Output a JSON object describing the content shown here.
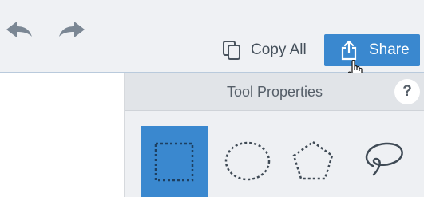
{
  "toolbar": {
    "undo_icon": "undo-arrow-icon",
    "redo_icon": "redo-arrow-icon",
    "copy_all_label": "Copy All",
    "copy_all_icon": "copy-icon",
    "share_label": "Share",
    "share_icon": "share-upload-icon"
  },
  "tool_properties": {
    "title": "Tool Properties",
    "help_label": "?",
    "tools": [
      {
        "name": "rectangle-selection",
        "icon": "dashed-rectangle-icon",
        "selected": true
      },
      {
        "name": "ellipse-selection",
        "icon": "dashed-ellipse-icon",
        "selected": false
      },
      {
        "name": "polygon-selection",
        "icon": "dashed-pentagon-icon",
        "selected": false
      },
      {
        "name": "lasso-selection",
        "icon": "lasso-icon",
        "selected": false
      }
    ]
  },
  "colors": {
    "accent": "#3a88cf",
    "toolbar_bg": "#eff1f4",
    "panel_bg": "#eef0f3",
    "header_bg": "#e1e4e8"
  }
}
